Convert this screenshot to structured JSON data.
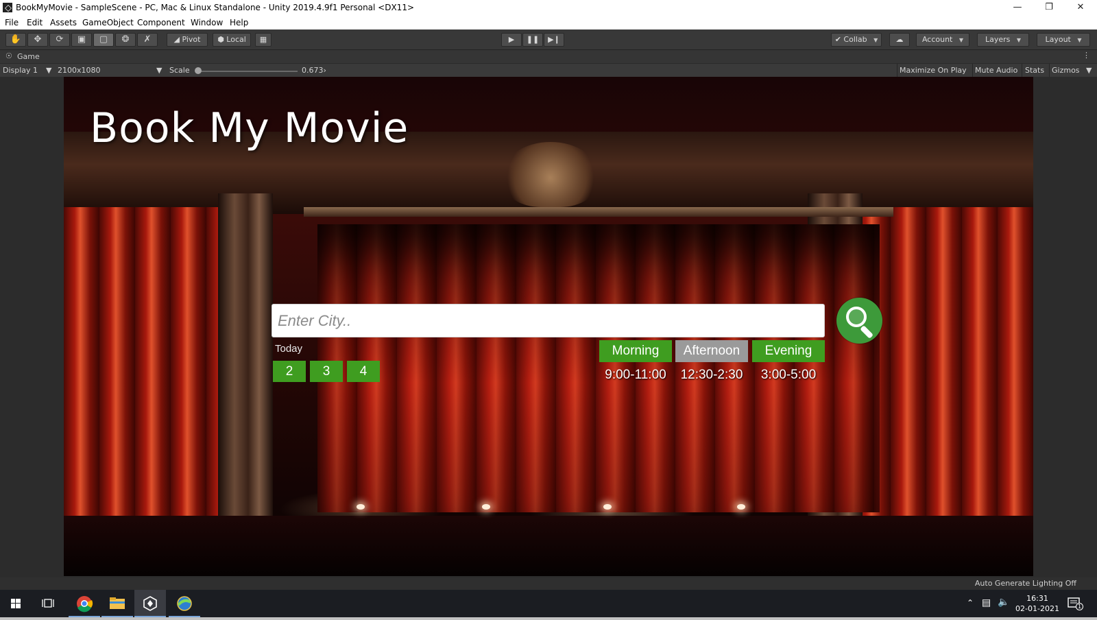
{
  "window": {
    "title": "BookMyMovie - SampleScene - PC, Mac & Linux Standalone - Unity 2019.4.9f1 Personal <DX11>",
    "minimize_icon": "minimize-icon",
    "maximize_icon": "restore-icon",
    "close_icon": "close-icon"
  },
  "menu": [
    "File",
    "Edit",
    "Assets",
    "GameObject",
    "Component",
    "Window",
    "Help"
  ],
  "toolbar": {
    "tools": [
      "hand-tool-icon",
      "move-tool-icon",
      "rotate-tool-icon",
      "scale-tool-icon",
      "rect-tool-icon",
      "transform-tool-icon",
      "custom-tool-icon"
    ],
    "pivot_label": "Pivot",
    "local_label": "Local",
    "collab_label": "Collab",
    "account_label": "Account",
    "layers_label": "Layers",
    "layout_label": "Layout"
  },
  "game_tab": {
    "label": "Game",
    "display": "Display 1",
    "resolution": "2100x1080",
    "scale_label": "Scale",
    "scale_value": "0.673",
    "scale_fraction": 0.08,
    "maximize_on_play": "Maximize On Play",
    "mute_audio": "Mute Audio",
    "stats": "Stats",
    "gizmos": "Gizmos"
  },
  "app": {
    "title": "Book My Movie",
    "city_placeholder": "Enter City..",
    "today_label": "Today",
    "days": [
      "2",
      "3",
      "4"
    ],
    "slots": [
      {
        "label": "Morning",
        "time": "9:00-11:00",
        "state": "selected"
      },
      {
        "label": "Afternoon",
        "time": "12:30-2:30",
        "state": "disabled"
      },
      {
        "label": "Evening",
        "time": "3:00-5:00",
        "state": "selected"
      }
    ],
    "colors": {
      "accent_green": "#3f9d20",
      "disabled_grey": "#9a9a9a",
      "search_green": "#3d9a3a"
    }
  },
  "status": {
    "lighting": "Auto Generate Lighting Off"
  },
  "taskbar": {
    "time": "16:31",
    "date": "02-01-2021",
    "notification_count": "1"
  }
}
